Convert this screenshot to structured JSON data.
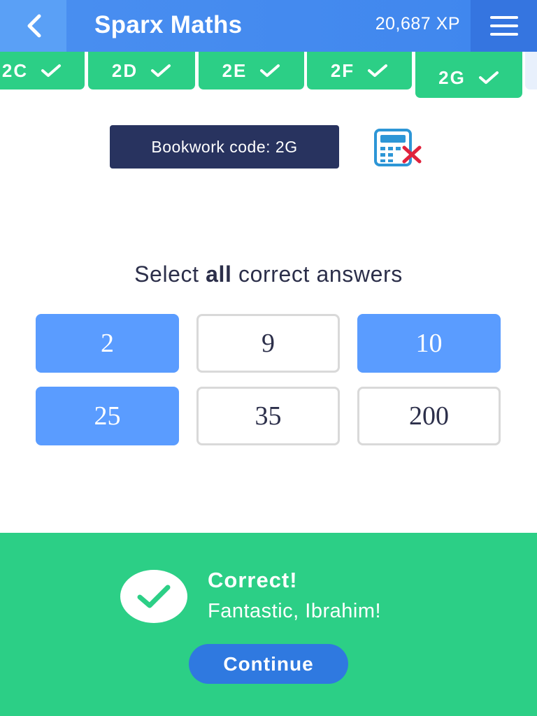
{
  "header": {
    "title": "Sparx Maths",
    "xp": "20,687 XP",
    "back_icon": "chevron-left-icon",
    "menu_icon": "hamburger-menu-icon"
  },
  "tabs": [
    {
      "label": "2C",
      "done": true
    },
    {
      "label": "2D",
      "done": true
    },
    {
      "label": "2E",
      "done": true
    },
    {
      "label": "2F",
      "done": true
    },
    {
      "label": "2G",
      "done": true,
      "active": true
    }
  ],
  "bookwork": {
    "label": "Bookwork code: 2G",
    "calculator_icon": "calculator-not-allowed-icon"
  },
  "question": {
    "prompt_before": "Select ",
    "prompt_bold": "all",
    "prompt_after": " correct answers",
    "options": [
      {
        "label": "2",
        "selected": true
      },
      {
        "label": "9",
        "selected": false
      },
      {
        "label": "10",
        "selected": true
      },
      {
        "label": "25",
        "selected": true
      },
      {
        "label": "35",
        "selected": false
      },
      {
        "label": "200",
        "selected": false
      }
    ]
  },
  "feedback": {
    "title": "Correct!",
    "message": "Fantastic, Ibrahim!",
    "continue_label": "Continue",
    "icon": "check-icon"
  },
  "colors": {
    "header": "#4a8ff0",
    "tab_green": "#2ccf86",
    "bookwork_bg": "#28335f",
    "selected_option": "#5a9cff",
    "continue_button": "#2f79e0"
  }
}
